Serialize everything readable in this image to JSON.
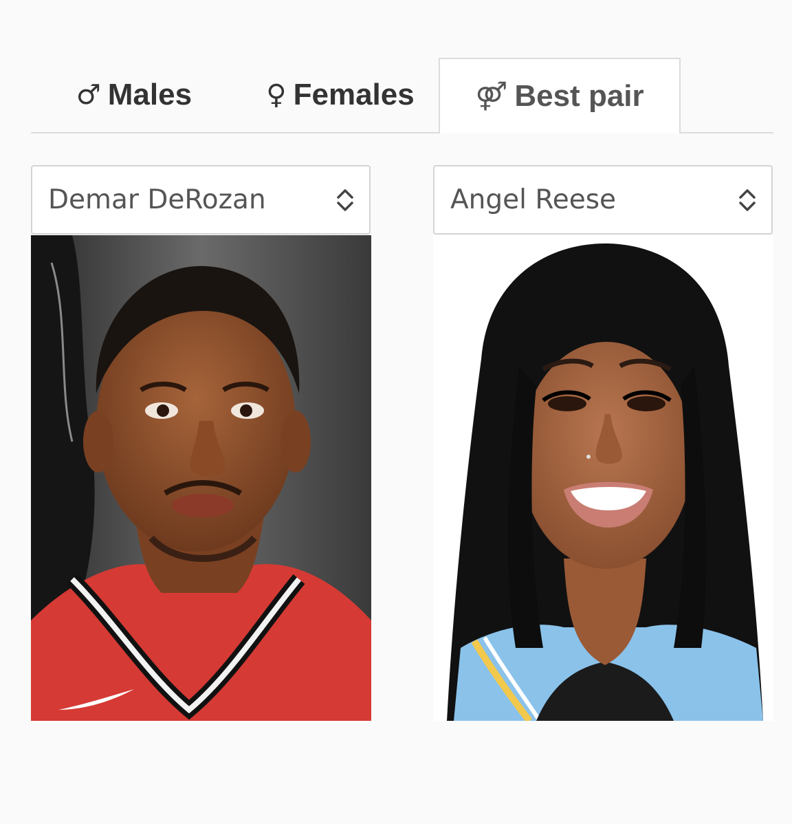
{
  "tabs": [
    {
      "icon": "♂",
      "icon_name": "male-icon",
      "label": "Males",
      "active": false
    },
    {
      "icon": "♀",
      "icon_name": "female-icon",
      "label": "Females",
      "active": false
    },
    {
      "icon": "⚤",
      "icon_name": "couple-icon",
      "label": "Best pair",
      "active": true
    }
  ],
  "selectors": {
    "left": {
      "value": "Demar DeRozan",
      "icon_name": "chevron-up-down-icon"
    },
    "right": {
      "value": "Angel Reese",
      "icon_name": "chevron-up-down-icon"
    }
  },
  "photos": {
    "left": {
      "jersey_color": "#d63a34",
      "background_color": "#4a4a4a"
    },
    "right": {
      "hair_color": "#111111",
      "background_color": "#ffffff"
    }
  },
  "colors": {
    "page_background": "#fafafa",
    "tab_text": "#333333",
    "tab_border": "#dcdcdc",
    "select_text": "#555555"
  }
}
